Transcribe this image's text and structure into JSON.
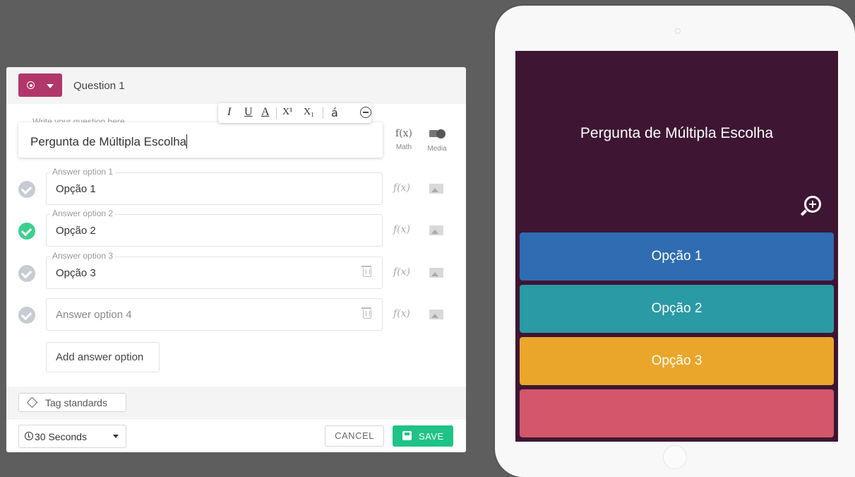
{
  "editor": {
    "question_label": "Question 1",
    "toolbar": {
      "italic": "I",
      "underline": "U",
      "color": "A",
      "superscript": "X¹",
      "subscript": "X₁",
      "accent": "á"
    },
    "question": {
      "caption": "Write your question here",
      "text": "Pergunta de Múltipla Escolha"
    },
    "math": {
      "icon": "f(x)",
      "label": "Math"
    },
    "media": {
      "label": "Media"
    },
    "answers": [
      {
        "caption": "Answer option 1",
        "text": "Opção 1",
        "correct": false
      },
      {
        "caption": "Answer option 2",
        "text": "Opção 2",
        "correct": true
      },
      {
        "caption": "Answer option 3",
        "text": "Opção 3",
        "correct": false
      },
      {
        "caption": "",
        "placeholder": "Answer option 4",
        "correct": false
      }
    ],
    "fx_label": "f(x)",
    "add_answer": "Add answer option",
    "tag_standards": "Tag standards",
    "time_limit": "30 Seconds",
    "cancel": "CANCEL",
    "save": "SAVE"
  },
  "preview": {
    "question": "Pergunta de Múltipla Escolha",
    "options": [
      {
        "text": "Opção 1",
        "color": "#2f6cb1"
      },
      {
        "text": "Opção 2",
        "color": "#2a9aa5"
      },
      {
        "text": "Opção 3",
        "color": "#eaa62b"
      },
      {
        "text": "",
        "color": "#d4566a"
      }
    ]
  },
  "colors": {
    "qtype_button": "#b2366a",
    "correct_check": "#3ccf8e",
    "unchecked": "#c7ccd4",
    "save_button": "#1fc387",
    "preview_background": "#3e1634"
  }
}
